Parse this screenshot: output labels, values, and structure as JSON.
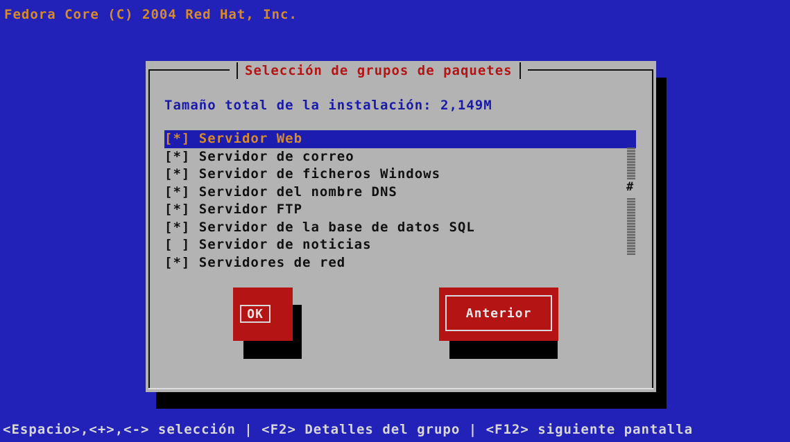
{
  "banner": "Fedora Core (C) 2004 Red Hat, Inc.",
  "dialog": {
    "title": "Selección de grupos de paquetes",
    "install_size": "Tamaño total de la instalación: 2,149M",
    "items": [
      {
        "label": "[*] Servidor Web",
        "selected": true
      },
      {
        "label": "[*] Servidor de correo",
        "selected": false
      },
      {
        "label": "[*] Servidor de ficheros Windows",
        "selected": false
      },
      {
        "label": "[*] Servidor del nombre DNS",
        "selected": false
      },
      {
        "label": "[*] Servidor FTP",
        "selected": false
      },
      {
        "label": "[*] Servidor de la base de datos SQL",
        "selected": false
      },
      {
        "label": "[ ] Servidor de noticias",
        "selected": false
      },
      {
        "label": "[*] Servidores de red",
        "selected": false
      }
    ],
    "scroll_thumb": "#",
    "ok_label": "OK",
    "back_label": "Anterior"
  },
  "hint": "<Espacio>,<+>,<-> selección | <F2> Detalles del grupo | <F12> siguiente pantalla",
  "colors": {
    "background": "#2222b8",
    "dialog_bg": "#b3b3b3",
    "title": "#b41414",
    "highlight": "#1c1cb0",
    "highlight_text": "#d68a2c",
    "button": "#b41414"
  }
}
